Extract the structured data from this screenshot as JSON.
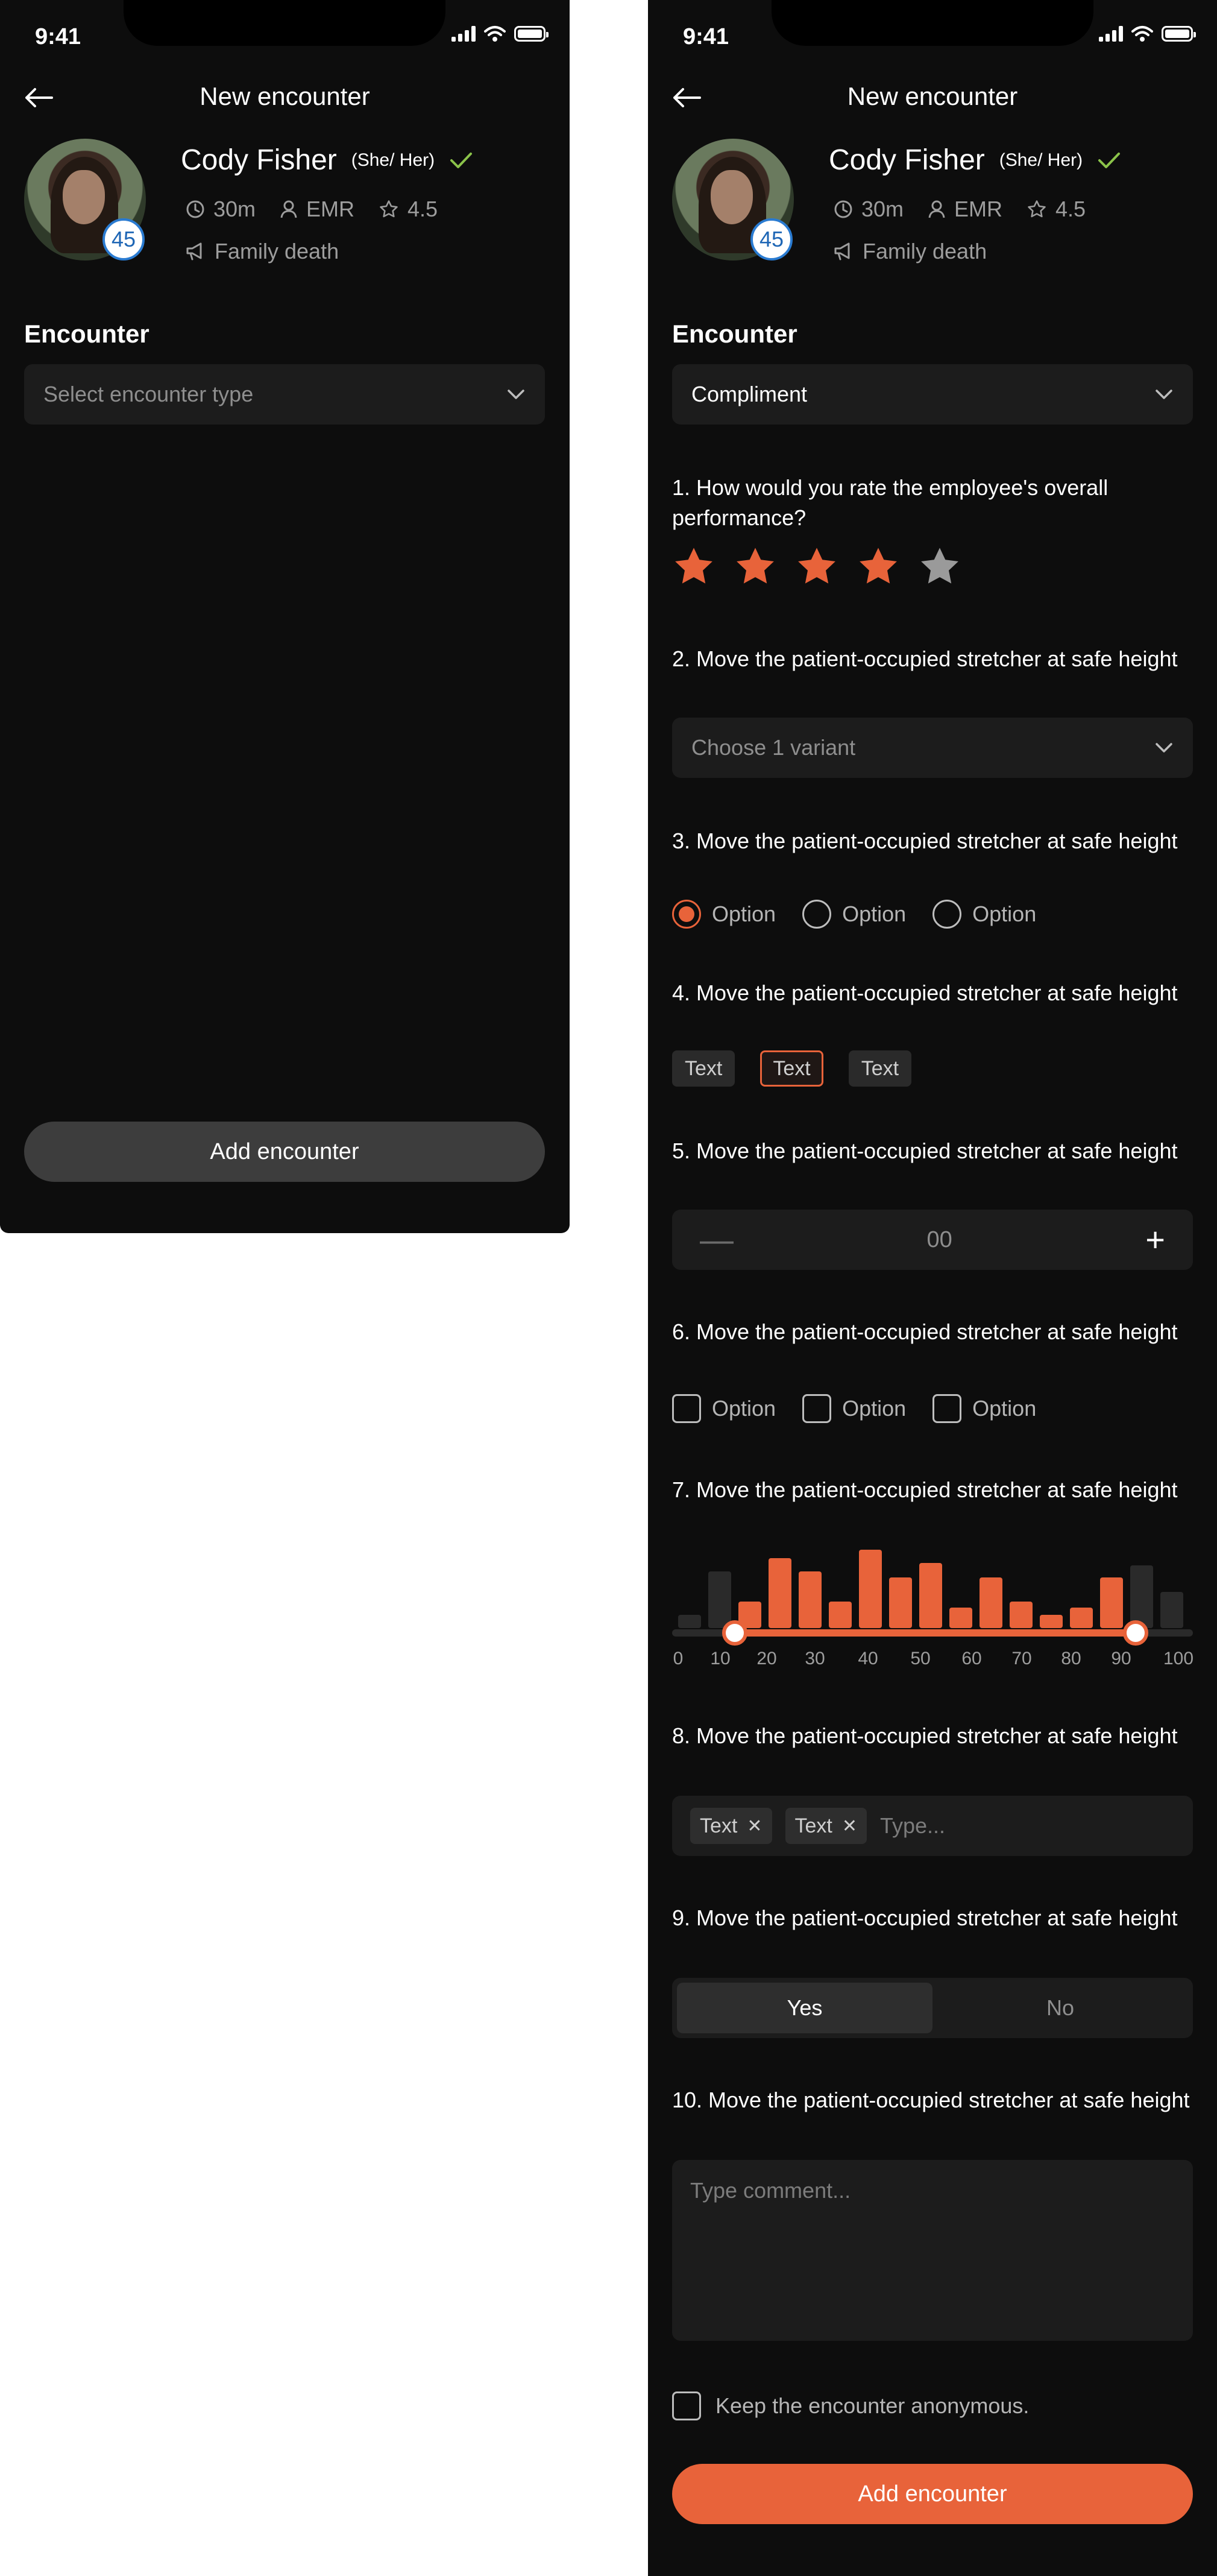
{
  "colors": {
    "background": "#0d0d0d",
    "accent": "#e8633a",
    "surface": "#1c1c1c",
    "verified": "#8bc34a",
    "age_badge": "#2a7bd1"
  },
  "status_bar": {
    "time": "9:41"
  },
  "header": {
    "title": "New encounter",
    "back_icon": "arrow-left-icon"
  },
  "patient": {
    "name": "Cody Fisher",
    "pronouns": "(She/ Her)",
    "age": "45",
    "duration": "30m",
    "source": "EMR",
    "rating": "4.5",
    "reason": "Family death"
  },
  "encounter_label": "Encounter",
  "left_screen": {
    "select_placeholder": "Select encounter type",
    "add_button": "Add encounter"
  },
  "right_screen": {
    "encounter_type": "Compliment",
    "questions": [
      {
        "label": "1. How would you rate the employee's overall performance?",
        "rating": 4,
        "max": 5
      },
      {
        "label": "2. Move the patient-occupied stretcher at safe height",
        "placeholder": "Choose 1 variant"
      },
      {
        "label": "3. Move the patient-occupied stretcher at safe height",
        "options": [
          "Option",
          "Option",
          "Option"
        ],
        "selected": 0
      },
      {
        "label": "4. Move the patient-occupied stretcher at safe height",
        "chips": [
          "Text",
          "Text",
          "Text"
        ],
        "selected": 1
      },
      {
        "label": "5. Move the patient-occupied stretcher at safe height",
        "value": "00"
      },
      {
        "label": "6. Move the patient-occupied stretcher at safe height",
        "options": [
          "Option",
          "Option",
          "Option"
        ]
      },
      {
        "label": "7. Move the patient-occupied stretcher at safe height",
        "range_low": 12,
        "range_high": 89,
        "ticks": [
          "0",
          "10",
          "20",
          "30",
          "40",
          "50",
          "60",
          "70",
          "80",
          "90",
          "100"
        ]
      },
      {
        "label": "8. Move the patient-occupied stretcher at safe height",
        "tags": [
          "Text",
          "Text"
        ],
        "placeholder": "Type..."
      },
      {
        "label": "9. Move the patient-occupied stretcher at safe height",
        "options": [
          "Yes",
          "No"
        ],
        "selected": 0
      },
      {
        "label": "10. Move the patient-occupied stretcher at safe height",
        "placeholder": "Type comment..."
      }
    ],
    "anonymous_label": "Keep the encounter anonymous.",
    "add_button": "Add encounter"
  }
}
